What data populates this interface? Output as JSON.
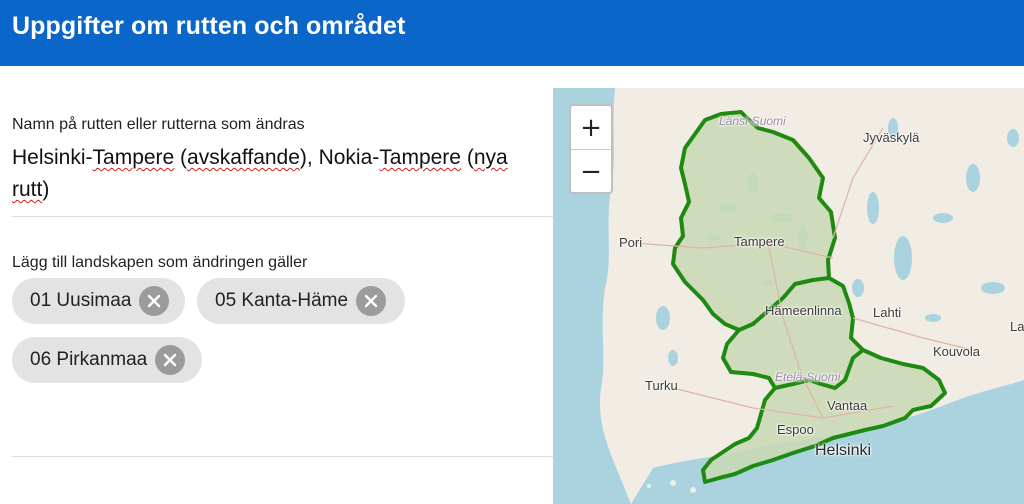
{
  "header": {
    "title": "Uppgifter om rutten och området"
  },
  "route_field": {
    "label": "Namn på rutten eller rutterna som ändras",
    "value_parts": [
      {
        "text": "Helsinki-",
        "spell": false
      },
      {
        "text": "Tampere",
        "spell": true
      },
      {
        "text": " (",
        "spell": false
      },
      {
        "text": "avskaffande",
        "spell": true
      },
      {
        "text": "), Nokia-",
        "spell": false
      },
      {
        "text": "Tampere",
        "spell": true
      },
      {
        "text": " (",
        "spell": false
      },
      {
        "text": "nya",
        "spell": true
      },
      {
        "text": " ",
        "spell": false
      },
      {
        "text": "rutt",
        "spell": true
      },
      {
        "text": ")",
        "spell": false
      }
    ]
  },
  "regions_field": {
    "label": "Lägg till landskapen som ändringen gäller",
    "chips": [
      {
        "label": "01 Uusimaa"
      },
      {
        "label": "05 Kanta-Häme"
      },
      {
        "label": "06 Pirkanmaa"
      }
    ]
  },
  "map": {
    "zoom_in": "+",
    "zoom_out": "−",
    "places": {
      "lansi_suomi": "Länsi-Suomi",
      "jyvaskyla": "Jyväskylä",
      "pori": "Pori",
      "tampere": "Tampere",
      "hameenlinna": "Hämeenlinna",
      "lahti": "Lahti",
      "la": "La",
      "kouvola": "Kouvola",
      "turku": "Turku",
      "etela_suomi": "Etelä-Suomi",
      "vantaa": "Vantaa",
      "espoo": "Espoo",
      "helsinki": "Helsinki"
    },
    "colors": {
      "land": "#f1ece4",
      "sea": "#aad3df",
      "region_fill": "#c9d9b4",
      "border": "#1f8a12"
    }
  }
}
